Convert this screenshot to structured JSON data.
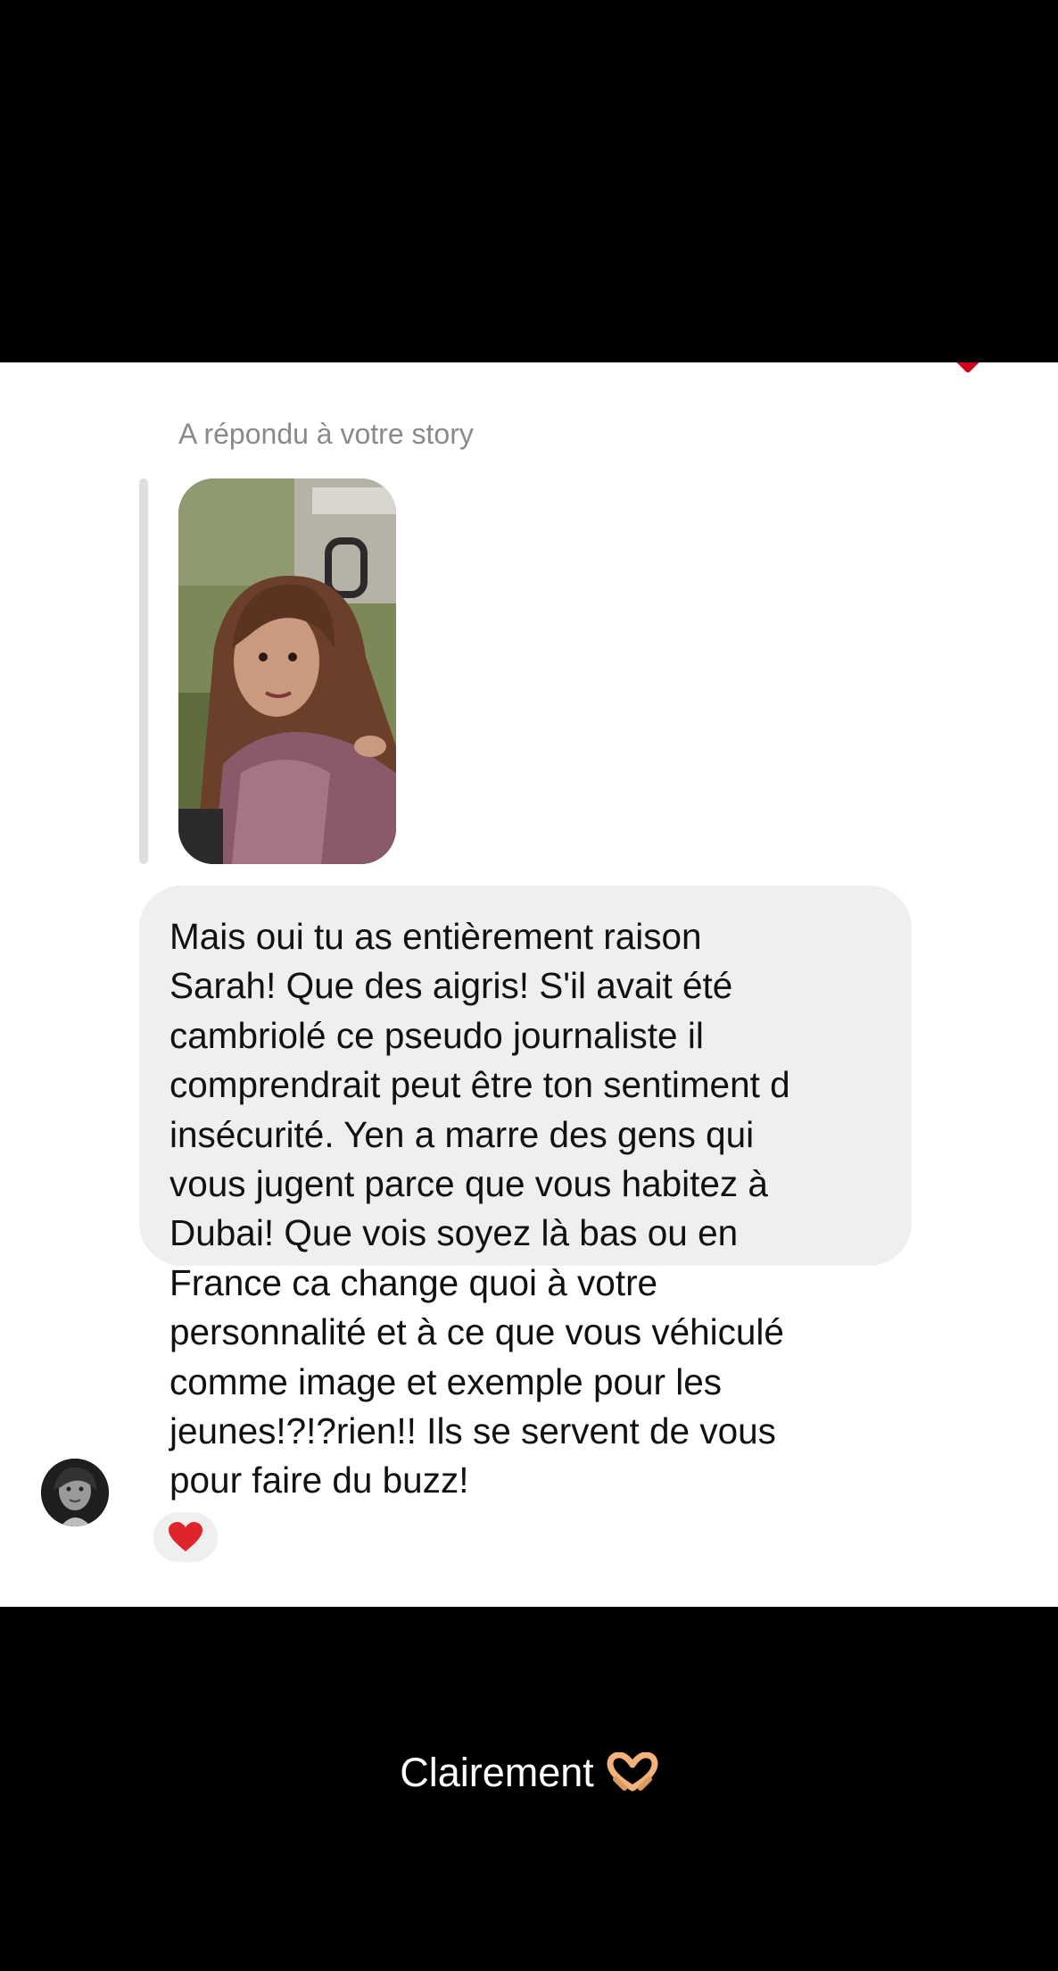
{
  "conversation": {
    "reply_note": "A répondu à votre story",
    "message_text": "Mais oui tu as entièrement raison\nSarah! Que des aigris! S'il avait été\ncambriolé ce pseudo journaliste il\ncomprendrait peut être ton sentiment d\ninsécurité. Yen a marre des gens qui\nvous jugent parce que vous habitez à\nDubai! Que vois soyez là  bas ou en\nFrance ca change quoi à votre\npersonnalité et à ce que vous véhiculé\ncomme image et exemple pour les\njeunes!?!?rien!! Ils se servent de vous\npour faire du buzz!",
    "reaction": "heart",
    "reaction_color": "#e0242b",
    "bubble_color": "#efefef"
  },
  "caption": {
    "text": "Clairement",
    "emoji": "heart-hands-icon"
  },
  "icons": {
    "corner": "heart-icon",
    "story": "story-thumbnail",
    "avatar": "user-avatar"
  }
}
